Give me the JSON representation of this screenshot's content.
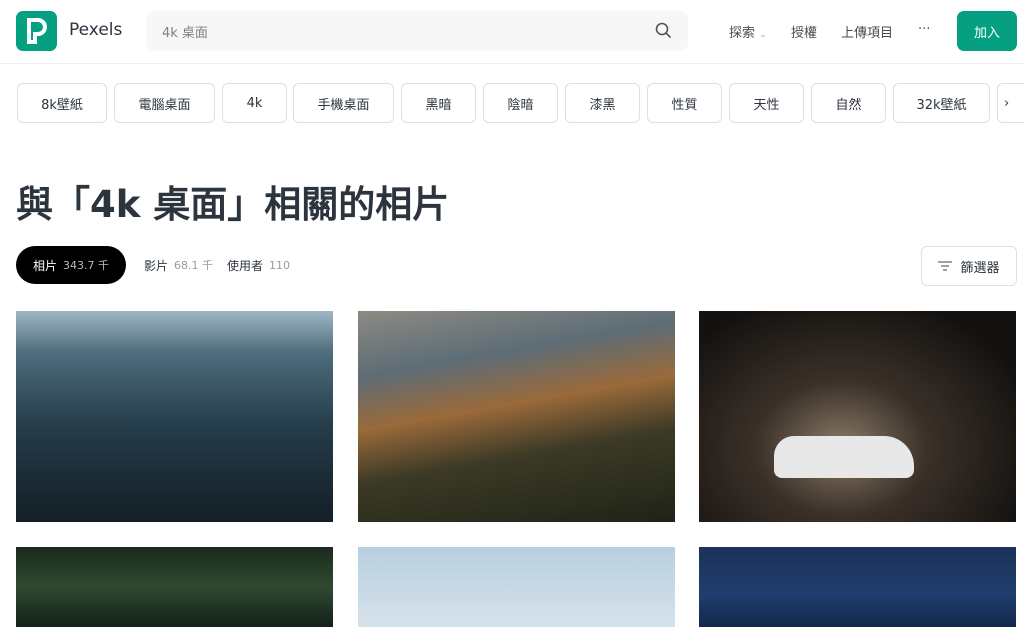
{
  "header": {
    "brand": "Pexels",
    "search_value": "4k 桌面",
    "nav": [
      {
        "label": "探索"
      },
      {
        "label": "授權"
      },
      {
        "label": "上傳項目"
      },
      {
        "label": "···"
      }
    ],
    "join_label": "加入"
  },
  "chips": [
    "8k壁紙",
    "電腦桌面",
    "4k",
    "手機桌面",
    "黑暗",
    "陰暗",
    "漆黑",
    "性質",
    "天性",
    "自然",
    "32k壁紙"
  ],
  "page_title": "與「4k 桌面」相關的相片",
  "tabs": [
    {
      "label": "相片",
      "count": "343.7 千"
    },
    {
      "label": "影片",
      "count": "68.1 千"
    },
    {
      "label": "使用者",
      "count": "110"
    }
  ],
  "filter_label": "篩選器",
  "colors": {
    "accent": "#05a081"
  },
  "photos": [
    "city-aerial",
    "mountain-coast",
    "white-car-night",
    "palm-leaves",
    "sky-haze",
    "night-sky"
  ]
}
